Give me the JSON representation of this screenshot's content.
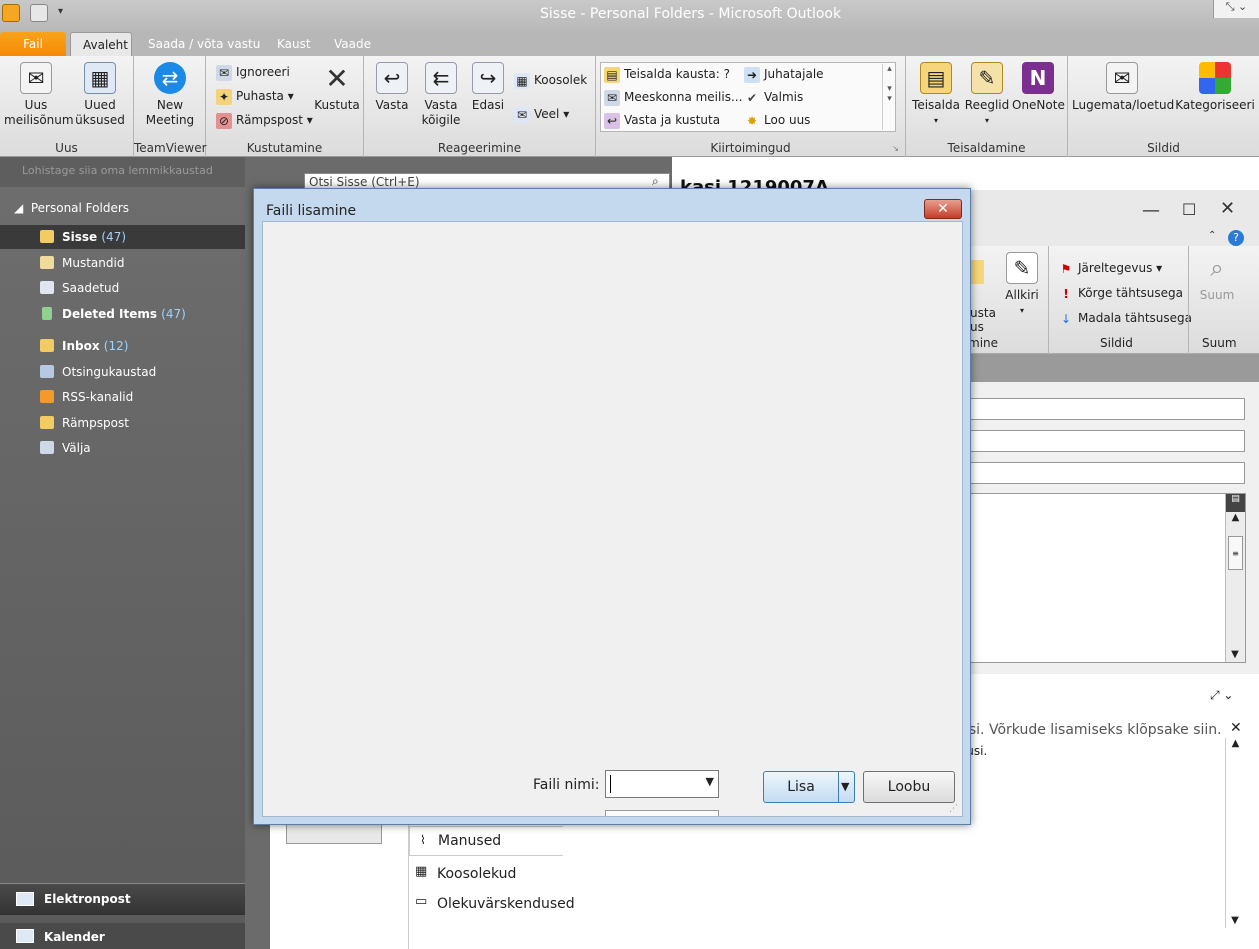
{
  "window": {
    "title": "Sisse - Personal Folders - Microsoft Outlook"
  },
  "tabs": {
    "file": "Fail",
    "home": "Avaleht",
    "send_receive": "Saada / võta vastu",
    "folder": "Kaust",
    "view": "Vaade"
  },
  "ribbon": {
    "new": {
      "new_email": "Uus\nmeilisõnum",
      "new_items": "Uued\nüksused",
      "label": "Uus"
    },
    "teamviewer": {
      "meeting": "New\nMeeting",
      "label": "TeamViewer"
    },
    "delete": {
      "ignore": "Ignoreeri",
      "clean": "Puhasta",
      "junk": "Rämpspost",
      "delete": "Kustuta",
      "label": "Kustutamine"
    },
    "respond": {
      "reply": "Vasta",
      "reply_all": "Vasta\nkõigile",
      "forward": "Edasi",
      "meeting": "Koosolek",
      "more": "Veel",
      "label": "Reageerimine"
    },
    "quick_steps": {
      "move_to": "Teisalda kausta: ?",
      "team_email": "Meeskonna meilis...",
      "reply_delete": "Vasta ja kustuta",
      "to_manager": "Juhatajale",
      "done": "Valmis",
      "create_new": "Loo uus",
      "label": "Kiirtoimingud"
    },
    "move": {
      "move": "Teisalda",
      "rules": "Reeglid",
      "onenote": "OneNote",
      "label": "Teisaldamine"
    },
    "tags": {
      "unread_read": "Lugemata/loetud",
      "categorize": "Kategoriseeri",
      "label": "Sildid"
    }
  },
  "nav": {
    "favorites_hint": "Lohistage siia oma lemmikkaustad",
    "root": "Personal Folders",
    "folders": [
      {
        "name": "Sisse",
        "count": "(47)"
      },
      {
        "name": "Mustandid",
        "count": ""
      },
      {
        "name": "Saadetud",
        "count": ""
      },
      {
        "name": "Deleted Items",
        "count": "(47)"
      },
      {
        "name": "Inbox",
        "count": "(12)"
      },
      {
        "name": "Otsingukaustad",
        "count": ""
      },
      {
        "name": "RSS-kanalid",
        "count": ""
      },
      {
        "name": "Rämpspost",
        "count": ""
      },
      {
        "name": "Välja",
        "count": ""
      }
    ],
    "bottom": {
      "mail": "Elektronpost",
      "calendar": "Kalender"
    }
  },
  "search": {
    "placeholder": "Otsi Sisse (Ctrl+E)"
  },
  "message": {
    "heading": "kasi 1219007A",
    "followup": "Järeltegevus",
    "high_importance": "Kõrge tähtsusega",
    "low_importance": "Madala tähtsusega",
    "signature": "Allkiri",
    "zoom": "Suum",
    "tags_label": "Sildid",
    "zoom_label": "Suum",
    "options_label": "mine",
    "attach_partial_top": "usta",
    "attach_partial_bottom": "us",
    "social_hint": "usi. Võrkude lisamiseks klõpsake siin.",
    "social_hint2": "susi.",
    "side_tabs": [
      "Manused",
      "Koosolekud",
      "Olekuvärskendused"
    ]
  },
  "dialog": {
    "title": "Faili lisamine",
    "filename_label": "Faili nimi:",
    "filename_value": "",
    "insert": "Lisa",
    "cancel": "Loobu"
  }
}
